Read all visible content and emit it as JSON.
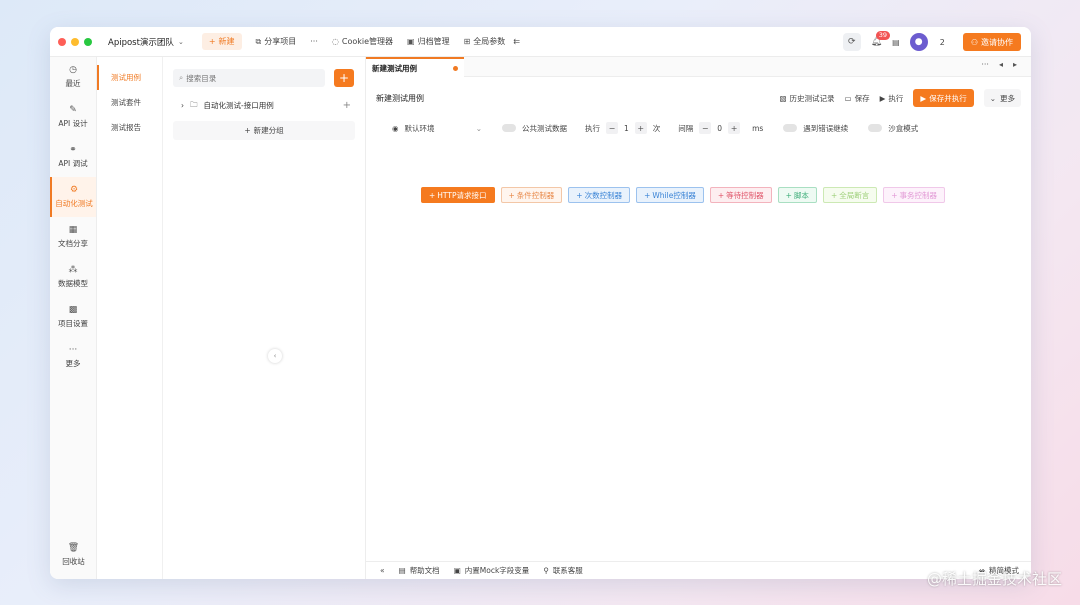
{
  "titlebar": {
    "team": "Apipost演示团队",
    "new_label": "新建",
    "items": [
      "分享项目",
      "Cookie管理器",
      "归档管理",
      "全局参数"
    ],
    "ellipsis": "···",
    "notif_count": "39",
    "member_count": "2",
    "invite_label": "邀请协作"
  },
  "sidebar": {
    "items": [
      {
        "label": "最近",
        "icon": "clock-icon"
      },
      {
        "label": "API 设计",
        "icon": "edit-icon"
      },
      {
        "label": "API 调试",
        "icon": "link-icon"
      },
      {
        "label": "自动化测试",
        "icon": "robot-icon"
      },
      {
        "label": "文档分享",
        "icon": "doc-icon"
      },
      {
        "label": "数据模型",
        "icon": "model-icon"
      },
      {
        "label": "项目设置",
        "icon": "settings-icon"
      },
      {
        "label": "更多",
        "icon": "more-icon"
      }
    ],
    "trash_label": "回收站"
  },
  "subnav": {
    "items": [
      "测试用例",
      "测试套件",
      "测试报告"
    ]
  },
  "tree": {
    "search_placeholder": "搜索目录",
    "folder_label": "自动化测试-接口用例",
    "new_group_label": "新建分组"
  },
  "main": {
    "tab_label": "新建测试用例",
    "title_value": "新建测试用例",
    "actions": {
      "history": "历史测试记录",
      "save": "保存",
      "run": "执行",
      "save_run": "保存并执行",
      "more": "更多"
    },
    "config": {
      "env": "默认环境",
      "public_data": "公共测试数据",
      "exec_label": "执行",
      "exec_count": "1",
      "times_unit": "次",
      "interval_label": "间隔",
      "interval_value": "0",
      "ms_unit": "ms",
      "error_continue": "遇到错误继续",
      "sandbox": "沙盒模式"
    },
    "chips": [
      {
        "label": "HTTP请求接口",
        "color": "#ffffff",
        "bg": "#f57a1f",
        "border": "#f57a1f"
      },
      {
        "label": "条件控制器",
        "color": "#e8894a",
        "bg": "#fff5ee",
        "border": "#f3c7a7"
      },
      {
        "label": "次数控制器",
        "color": "#3b84d6",
        "bg": "#e9f2fc",
        "border": "#9cc2ee"
      },
      {
        "label": "While控制器",
        "color": "#3b84d6",
        "bg": "#e9f2fc",
        "border": "#9cc2ee"
      },
      {
        "label": "等待控制器",
        "color": "#e0556a",
        "bg": "#fdeef0",
        "border": "#f3b3bd"
      },
      {
        "label": "脚本",
        "color": "#3fae7a",
        "bg": "#eefaf3",
        "border": "#a9dfc2"
      },
      {
        "label": "全局断言",
        "color": "#9ed07a",
        "bg": "#f6fcef",
        "border": "#cce9b4"
      },
      {
        "label": "事务控制器",
        "color": "#e29ad6",
        "bg": "#fdf2fb",
        "border": "#f0c8e9"
      }
    ]
  },
  "footer": {
    "help": "帮助文档",
    "mock": "内置Mock字段变量",
    "support": "联系客服",
    "simple_mode": "精简模式",
    "watermark": "@稀土掘金技术社区"
  },
  "colors": {
    "accent": "#f57a1f"
  }
}
